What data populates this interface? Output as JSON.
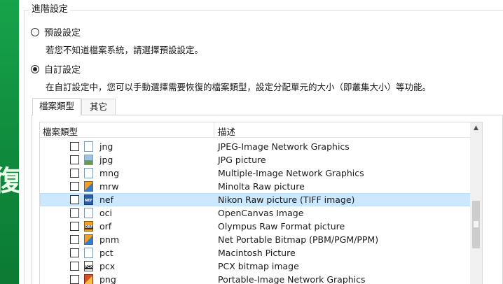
{
  "brand": {
    "glyph": "復"
  },
  "group": {
    "title": "進階設定"
  },
  "options": {
    "default": {
      "label": "預設設定",
      "description": "若您不知道檔案系統，請選擇預設設定。",
      "checked": false
    },
    "custom": {
      "label": "自訂設定",
      "description": "在自訂設定中，您可以手動選擇需要恢復的檔案類型，設定分配單元的大小（即叢集大小）等功能。",
      "checked": true
    }
  },
  "tabs": [
    {
      "label": "檔案類型",
      "active": true
    },
    {
      "label": "其它",
      "active": false
    }
  ],
  "list": {
    "columns": {
      "type": "檔案類型",
      "description": "描述"
    },
    "rows": [
      {
        "ext": "jng",
        "description": "JPEG-Image Network Graphics",
        "icon": "file-icon",
        "checked": false,
        "selected": false
      },
      {
        "ext": "jpg",
        "description": "JPG picture",
        "icon": "image-icon",
        "checked": false,
        "selected": false
      },
      {
        "ext": "mng",
        "description": "Multiple-Image Network Graphics",
        "icon": "file-icon",
        "checked": false,
        "selected": false
      },
      {
        "ext": "mrw",
        "description": "Minolta Raw picture",
        "icon": "raw-icon",
        "checked": false,
        "selected": false
      },
      {
        "ext": "nef",
        "description": "Nikon Raw picture (TIFF image)",
        "icon": "nef-icon",
        "checked": false,
        "selected": true
      },
      {
        "ext": "oci",
        "description": "OpenCanvas Image",
        "icon": "file-icon",
        "checked": false,
        "selected": false
      },
      {
        "ext": "orf",
        "description": "Olympus Raw Format picture",
        "icon": "orf-icon",
        "checked": false,
        "selected": false
      },
      {
        "ext": "pnm",
        "description": "Net Portable Bitmap (PBM/PGM/PPM)",
        "icon": "raw-icon",
        "checked": false,
        "selected": false
      },
      {
        "ext": "pct",
        "description": "Macintosh Picture",
        "icon": "file-icon",
        "checked": false,
        "selected": false
      },
      {
        "ext": "pcx",
        "description": "PCX bitmap image",
        "icon": "pcx-icon",
        "checked": false,
        "selected": false
      },
      {
        "ext": "png",
        "description": "Portable-Image Network Graphics",
        "icon": "png-icon",
        "checked": false,
        "selected": false
      }
    ]
  },
  "colors": {
    "brand_green": "#17a34a",
    "selection": "#cce8ff"
  }
}
